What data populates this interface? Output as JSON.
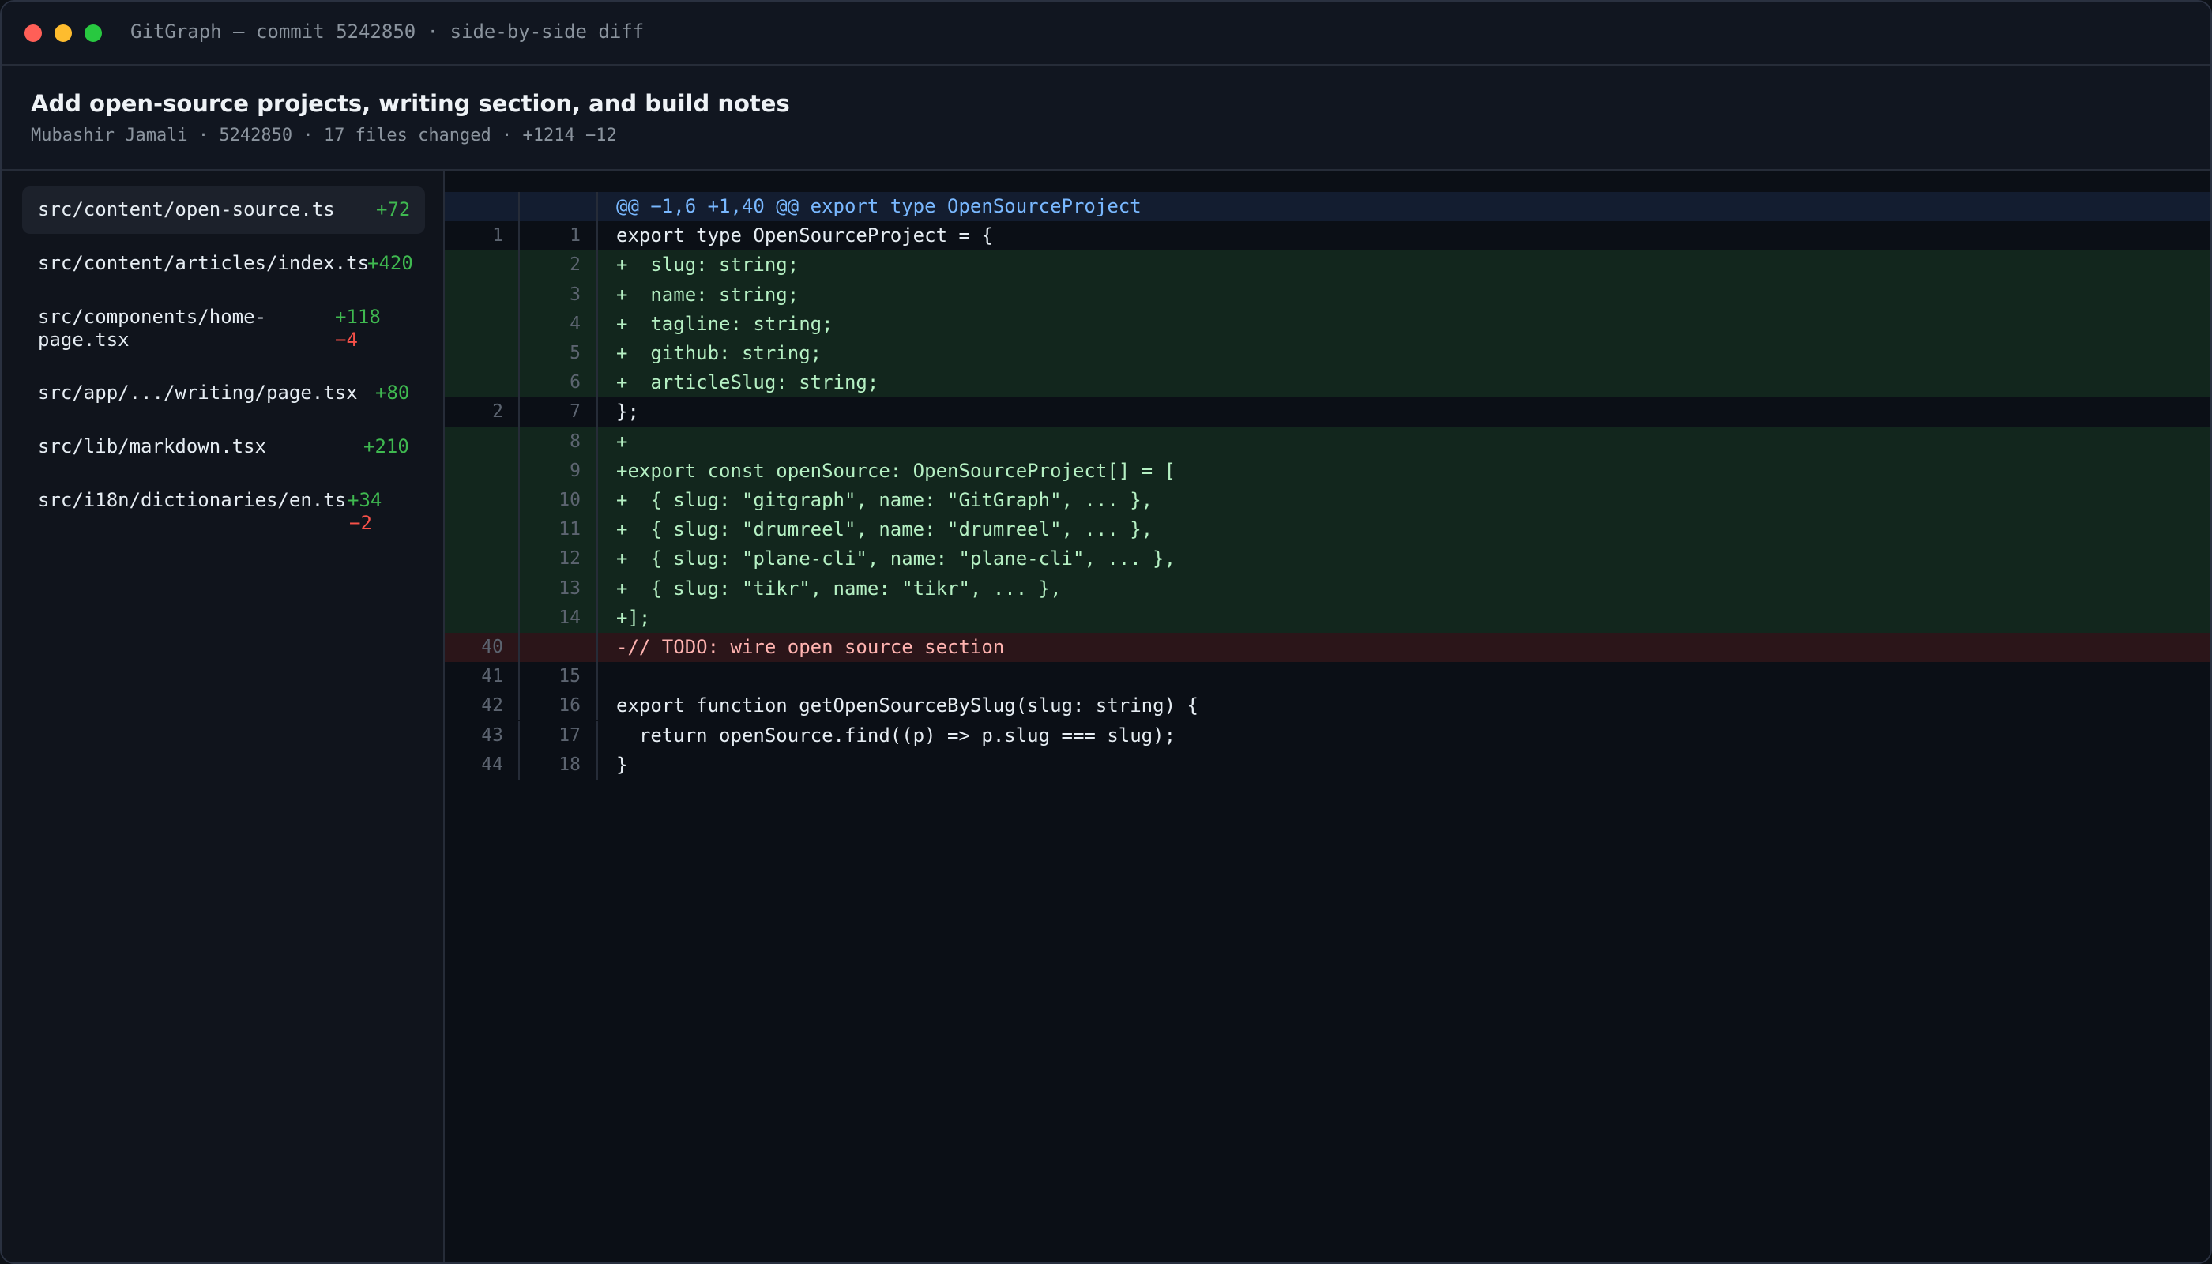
{
  "window": {
    "title": "GitGraph — commit 5242850 · side-by-side diff"
  },
  "commit": {
    "title": "Add open-source projects, writing section, and build notes",
    "meta": "Mubashir Jamali · 5242850 · 17 files changed · +1214 −12"
  },
  "files": [
    {
      "path_lines": [
        "src/content/open-source.ts"
      ],
      "additions": "+72",
      "deletions": ""
    },
    {
      "path_lines": [
        "src/content/articles/index.ts"
      ],
      "additions": "+420",
      "deletions": ""
    },
    {
      "path_lines": [
        "src/components/home-",
        "page.tsx"
      ],
      "additions": "+118",
      "deletions": "−4"
    },
    {
      "path_lines": [
        "src/app/.../writing/page.tsx"
      ],
      "additions": "+80",
      "deletions": ""
    },
    {
      "path_lines": [
        "src/lib/markdown.tsx"
      ],
      "additions": "+210",
      "deletions": ""
    },
    {
      "path_lines": [
        "src/i18n/dictionaries/en.ts"
      ],
      "additions": "+34",
      "deletions": "−2"
    }
  ],
  "diff": {
    "hunk_header": "@@ −1,6 +1,40 @@ export type OpenSourceProject",
    "lines": [
      {
        "type": "ctx",
        "old": "1",
        "new": "1",
        "text": "export type OpenSourceProject = {"
      },
      {
        "type": "added",
        "old": "",
        "new": "2",
        "text": "+  slug: string;"
      },
      {
        "type": "added",
        "old": "",
        "new": "3",
        "text": "+  name: string;"
      },
      {
        "type": "added",
        "old": "",
        "new": "4",
        "text": "+  tagline: string;"
      },
      {
        "type": "added",
        "old": "",
        "new": "5",
        "text": "+  github: string;"
      },
      {
        "type": "added",
        "old": "",
        "new": "6",
        "text": "+  articleSlug: string;"
      },
      {
        "type": "ctx",
        "old": "2",
        "new": "7",
        "text": "};"
      },
      {
        "type": "added",
        "old": "",
        "new": "8",
        "text": "+"
      },
      {
        "type": "added",
        "old": "",
        "new": "9",
        "text": "+export const openSource: OpenSourceProject[] = ["
      },
      {
        "type": "added",
        "old": "",
        "new": "10",
        "text": "+  { slug: \"gitgraph\", name: \"GitGraph\", ... },"
      },
      {
        "type": "added",
        "old": "",
        "new": "11",
        "text": "+  { slug: \"drumreel\", name: \"drumreel\", ... },"
      },
      {
        "type": "added",
        "old": "",
        "new": "12",
        "text": "+  { slug: \"plane-cli\", name: \"plane-cli\", ... },"
      },
      {
        "type": "added",
        "old": "",
        "new": "13",
        "text": "+  { slug: \"tikr\", name: \"tikr\", ... },"
      },
      {
        "type": "added",
        "old": "",
        "new": "14",
        "text": "+];"
      },
      {
        "type": "removed",
        "old": "40",
        "new": "",
        "text": "-// TODO: wire open source section"
      },
      {
        "type": "ctx",
        "old": "41",
        "new": "15",
        "text": ""
      },
      {
        "type": "ctx",
        "old": "42",
        "new": "16",
        "text": "export function getOpenSourceBySlug(slug: string) {"
      },
      {
        "type": "ctx",
        "old": "43",
        "new": "17",
        "text": "  return openSource.find((p) => p.slug === slug);"
      },
      {
        "type": "ctx",
        "old": "44",
        "new": "18",
        "text": "}"
      }
    ]
  },
  "colors": {
    "added_bg": "#12261d",
    "removed_bg": "#2b1519",
    "hunk_bg": "#131d30",
    "add_text": "#3fb950",
    "del_text": "#f85149"
  }
}
